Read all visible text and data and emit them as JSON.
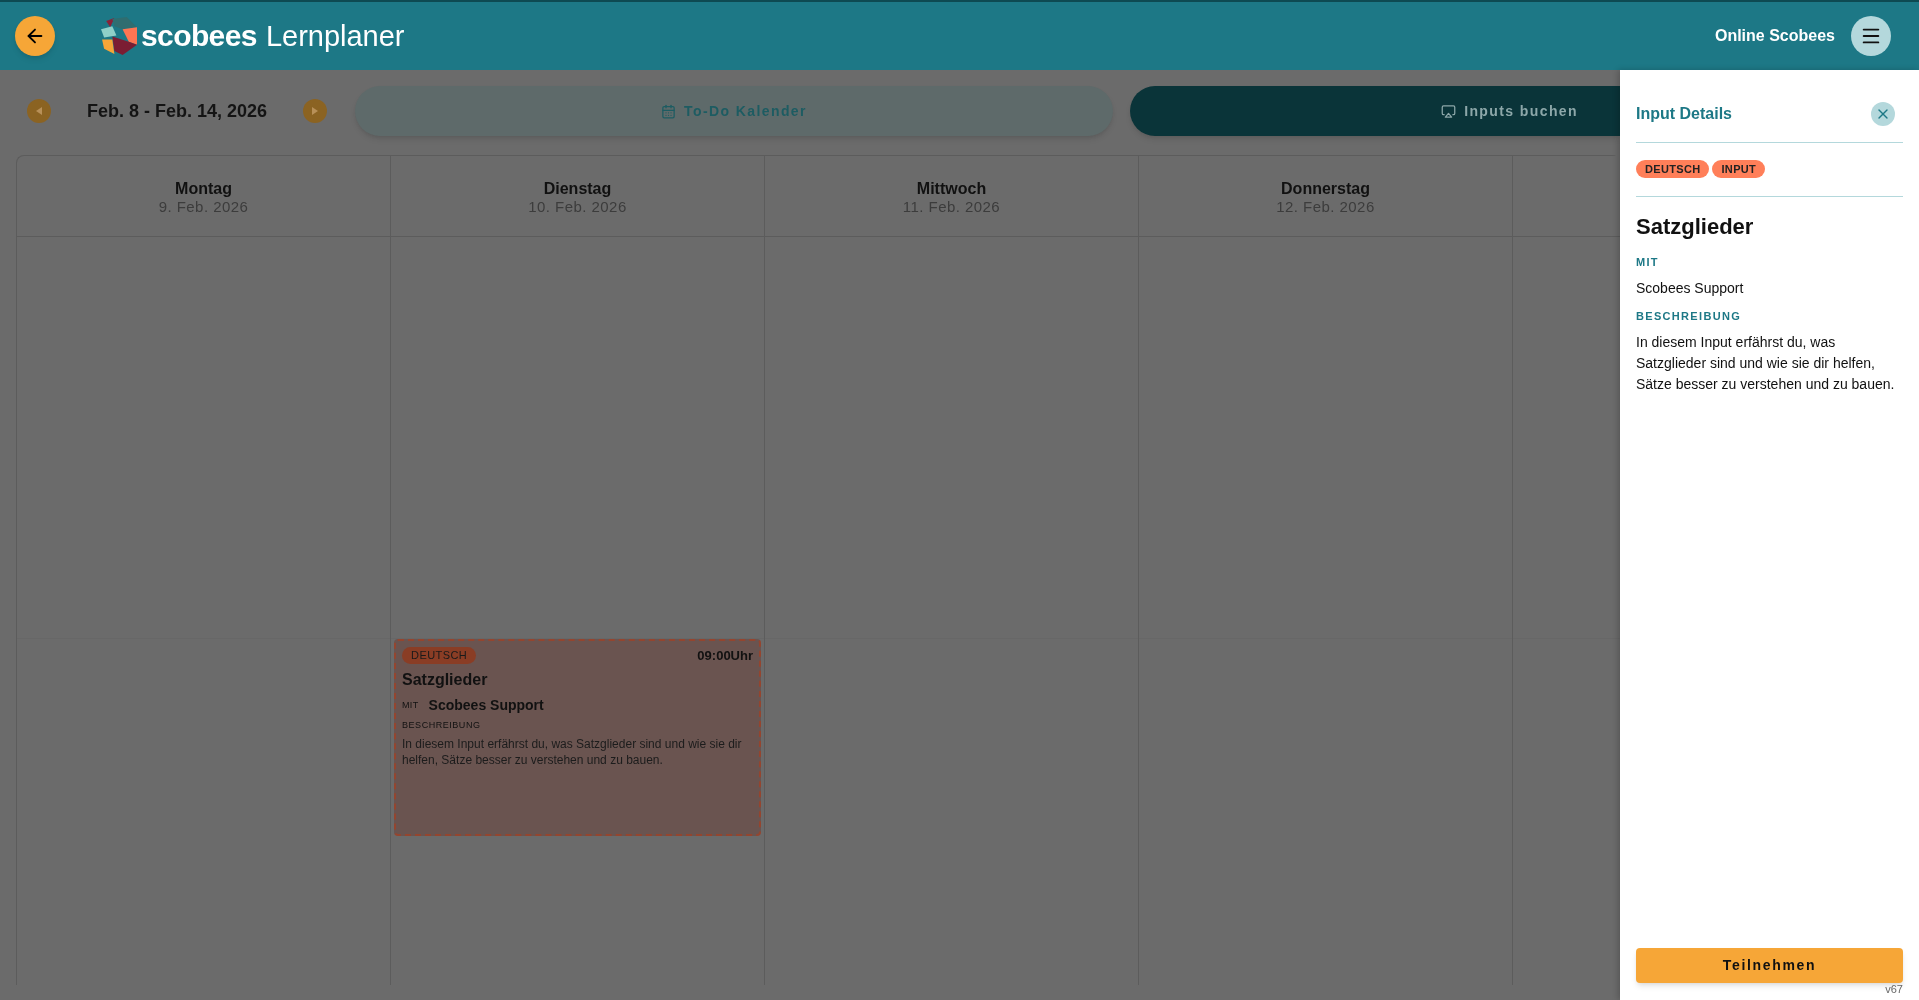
{
  "header": {
    "brand": "scobees",
    "product": "Lernplaner",
    "user": "Online Scobees"
  },
  "week_nav": {
    "range": "Feb. 8 - Feb. 14, 2026"
  },
  "view_tabs": [
    {
      "label": "To-Do Kalender",
      "selected": false
    },
    {
      "label": "Inputs buchen",
      "selected": true
    }
  ],
  "calendar": {
    "days": [
      {
        "name": "Montag",
        "date": "9. Feb. 2026"
      },
      {
        "name": "Dienstag",
        "date": "10. Feb. 2026",
        "events": [
          {
            "subject": "DEUTSCH",
            "time": "09:00Uhr",
            "title": "Satzglieder",
            "with_label": "MIT",
            "with": "Scobees Support",
            "description_label": "BESCHREIBUNG",
            "description": "In diesem Input erfährst du, was Satzglieder sind und wie sie dir helfen, Sätze besser zu verstehen und zu bauen."
          }
        ]
      },
      {
        "name": "Mittwoch",
        "date": "11. Feb. 2026"
      },
      {
        "name": "Donnerstag",
        "date": "12. Feb. 2026"
      }
    ]
  },
  "details_panel": {
    "title": "Input Details",
    "tags": [
      "DEUTSCH",
      "INPUT"
    ],
    "name": "Satzglieder",
    "with_label": "MIT",
    "with": "Scobees Support",
    "description_label": "BESCHREIBUNG",
    "description": "In diesem Input erfährst du, was Satzglieder sind und wie sie dir helfen, Sätze besser zu verstehen und zu bauen.",
    "button": "Teilnehmen"
  },
  "version": "v67"
}
